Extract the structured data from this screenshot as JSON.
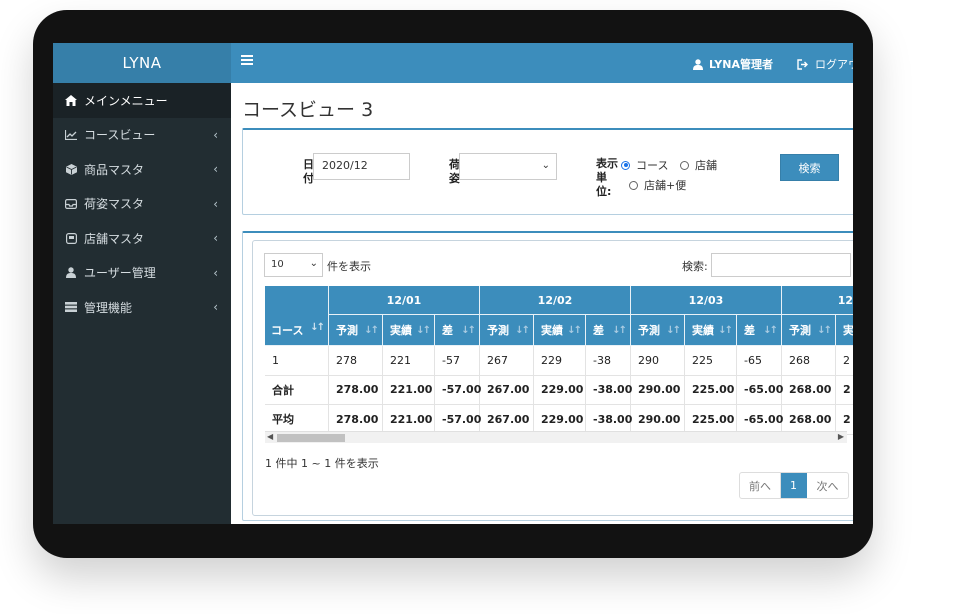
{
  "sidebar": {
    "brand": "LYNA",
    "items": [
      {
        "label": "メインメニュー",
        "icon": "home-icon"
      },
      {
        "label": "コースビュー",
        "icon": "line-chart-icon"
      },
      {
        "label": "商品マスタ",
        "icon": "cube-icon"
      },
      {
        "label": "荷姿マスタ",
        "icon": "inbox-icon"
      },
      {
        "label": "店舗マスタ",
        "icon": "store-icon"
      },
      {
        "label": "ユーザー管理",
        "icon": "user-icon"
      },
      {
        "label": "管理機能",
        "icon": "server-icon"
      }
    ]
  },
  "header": {
    "user": "LYNA管理者",
    "logout": "ログアウ"
  },
  "page": {
    "title": "コースビュー 3"
  },
  "filters": {
    "date_label_1": "日",
    "date_label_2": "付",
    "date_value": "2020/12",
    "package_label_1": "荷",
    "package_label_2": "姿",
    "unit_label_1": "表示",
    "unit_label_2": "単",
    "unit_label_3": "位:",
    "option_course": "コース",
    "option_store": "店舗",
    "option_store_flight": "店舗+便",
    "search_button": "検索"
  },
  "table": {
    "length_value": "10",
    "length_suffix": "件を表示",
    "search_label": "検索:",
    "col_course": "コース",
    "dates": [
      "12/01",
      "12/02",
      "12/03",
      "12"
    ],
    "sub_headers": [
      "予測",
      "実績",
      "差",
      "予測",
      "実績",
      "差",
      "予測",
      "実績",
      "差",
      "予測",
      "実"
    ],
    "rows": [
      {
        "label": "1",
        "values": [
          "278",
          "221",
          "-57",
          "267",
          "229",
          "-38",
          "290",
          "225",
          "-65",
          "268",
          "2"
        ]
      },
      {
        "label": "合計",
        "values": [
          "278.00",
          "221.00",
          "-57.00",
          "267.00",
          "229.00",
          "-38.00",
          "290.00",
          "225.00",
          "-65.00",
          "268.00",
          "2"
        ]
      },
      {
        "label": "平均",
        "values": [
          "278.00",
          "221.00",
          "-57.00",
          "267.00",
          "229.00",
          "-38.00",
          "290.00",
          "225.00",
          "-65.00",
          "268.00",
          "2"
        ]
      }
    ],
    "info": "1 件中 1 ~ 1 件を表示",
    "prev": "前へ",
    "page": "1",
    "next": "次へ"
  },
  "colors": {
    "brand": "#367fa9",
    "header": "#3c8dbc",
    "sidebar": "#222d32"
  }
}
